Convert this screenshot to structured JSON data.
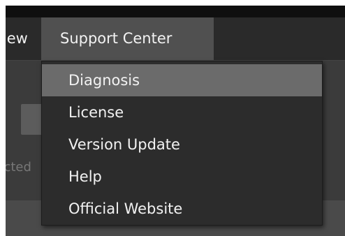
{
  "menubar": {
    "partial_item_label": "View",
    "support_center_label": "Support Center"
  },
  "background": {
    "partial_status_text": "Connected"
  },
  "dropdown": {
    "items": [
      {
        "label": "Diagnosis",
        "highlighted": true
      },
      {
        "label": "License",
        "highlighted": false
      },
      {
        "label": "Version Update",
        "highlighted": false
      },
      {
        "label": "Help",
        "highlighted": false
      },
      {
        "label": "Official Website",
        "highlighted": false
      }
    ]
  },
  "colors": {
    "menubar_bg": "#2a2a2a",
    "active_menu_bg": "#505050",
    "dropdown_bg": "#2c2c2c",
    "highlight_bg": "#6b6b6b",
    "text": "#f2f2f2"
  }
}
